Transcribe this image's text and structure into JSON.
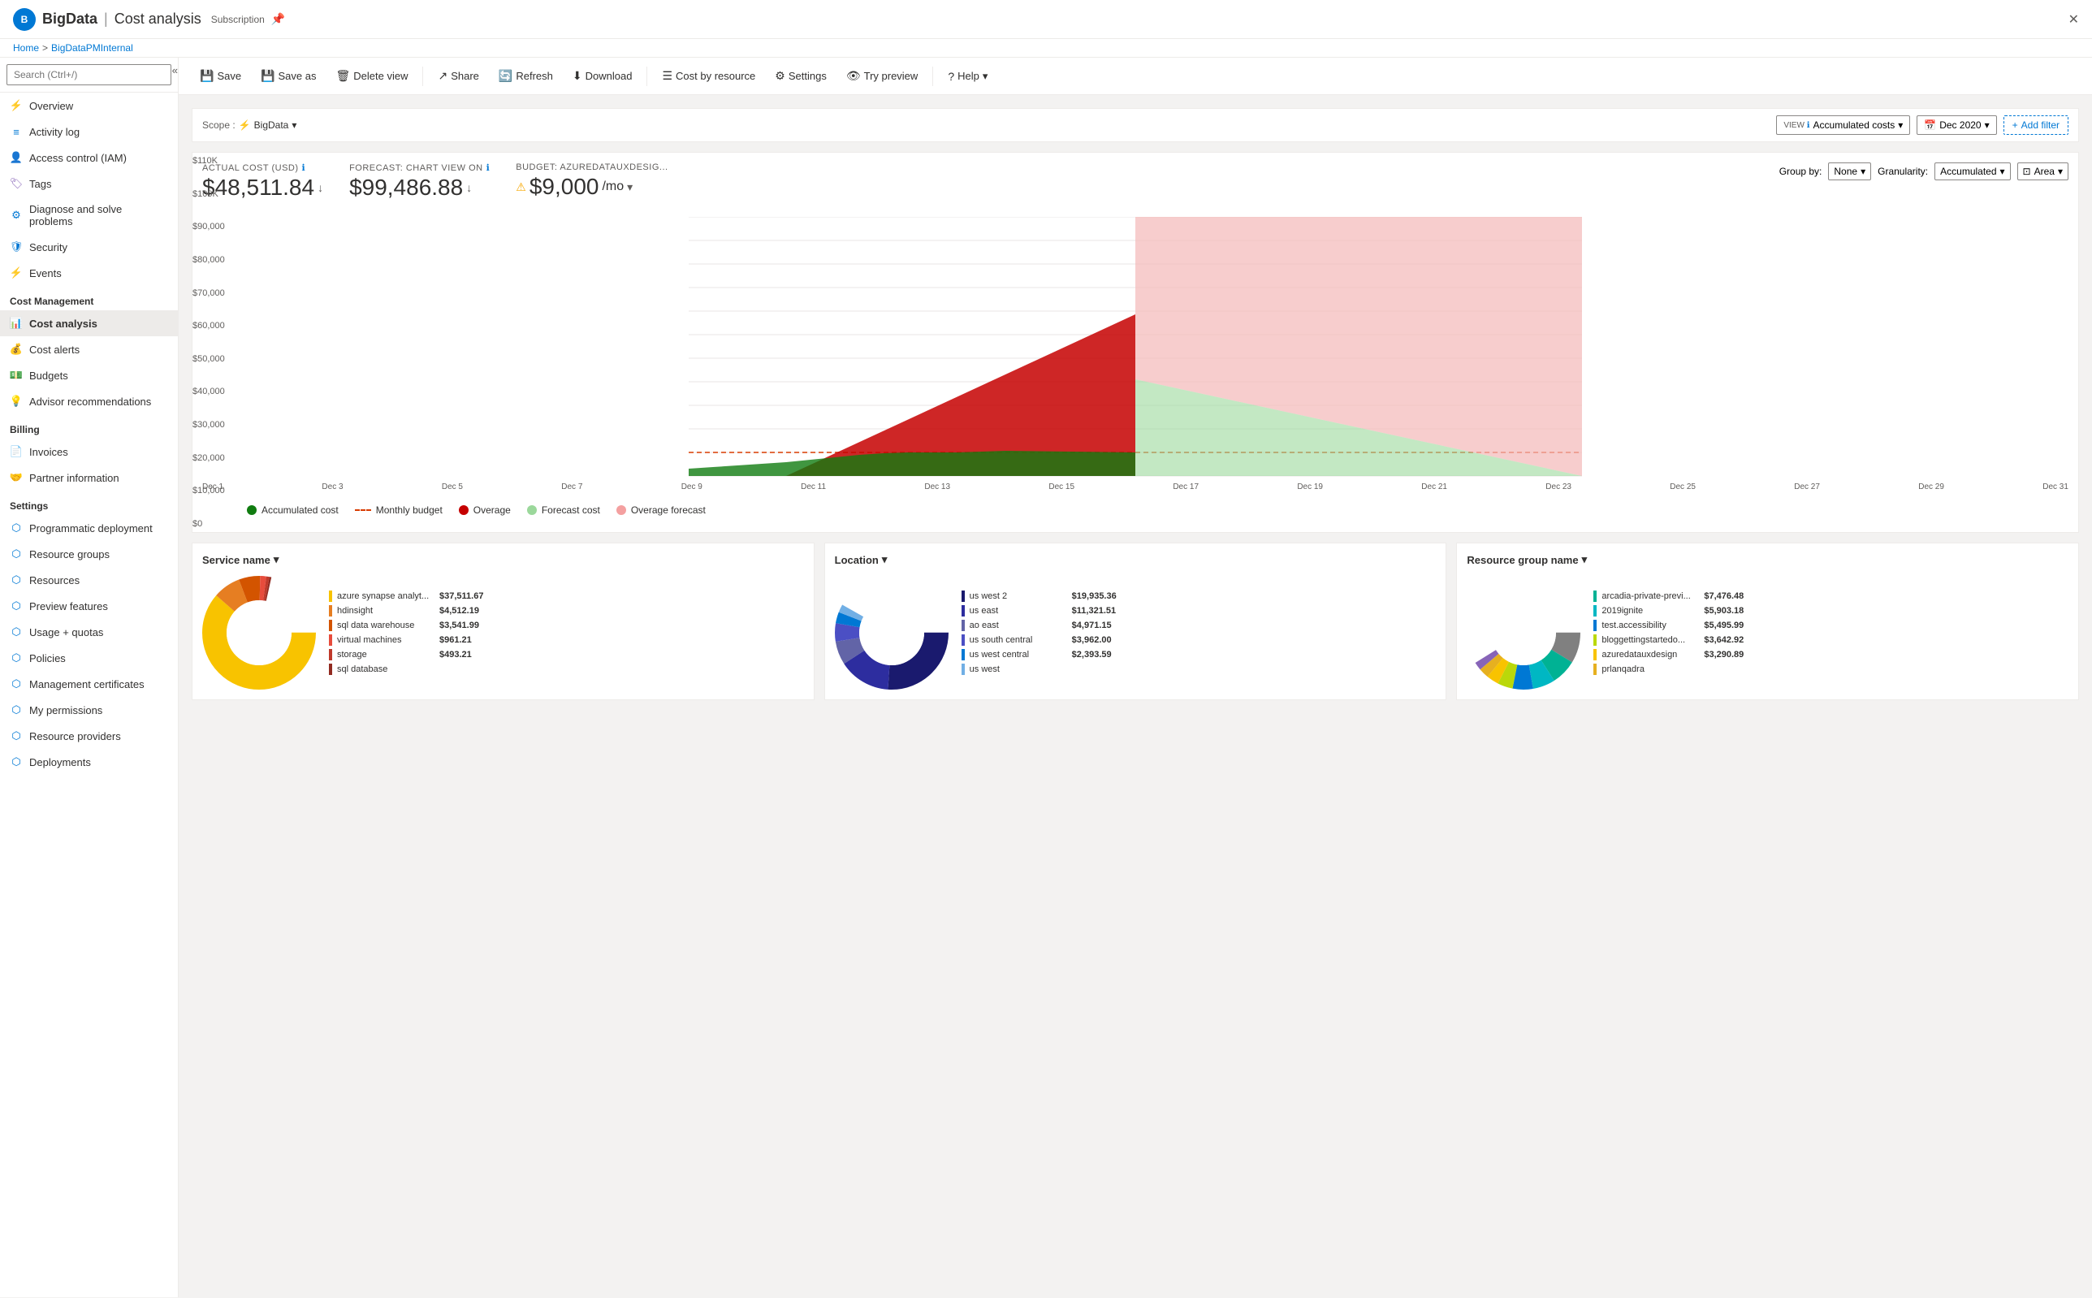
{
  "topbar": {
    "logo_text": "B",
    "main_title": "BigData",
    "separator": "|",
    "sub_title": "Cost analysis",
    "sub_label": "Subscription",
    "breadcrumb_home": "Home",
    "breadcrumb_arrow": ">",
    "breadcrumb_sub": "BigDataPMInternal",
    "close_icon": "✕",
    "pin_icon": "📌"
  },
  "sidebar": {
    "search_placeholder": "Search (Ctrl+/)",
    "collapse_icon": "«",
    "items": [
      {
        "id": "overview",
        "label": "Overview",
        "icon": "⚡",
        "color": "#f8a800"
      },
      {
        "id": "activity-log",
        "label": "Activity log",
        "icon": "≡",
        "color": "#0078d4"
      },
      {
        "id": "access-control",
        "label": "Access control (IAM)",
        "icon": "👤",
        "color": "#0078d4"
      },
      {
        "id": "tags",
        "label": "Tags",
        "icon": "🏷",
        "color": "#8764b8"
      },
      {
        "id": "diagnose",
        "label": "Diagnose and solve problems",
        "icon": "⚙",
        "color": "#0078d4"
      },
      {
        "id": "security",
        "label": "Security",
        "icon": "🛡",
        "color": "#0078d4"
      },
      {
        "id": "events",
        "label": "Events",
        "icon": "⚡",
        "color": "#f8a800"
      }
    ],
    "cost_management_label": "Cost Management",
    "cost_items": [
      {
        "id": "cost-analysis",
        "label": "Cost analysis",
        "icon": "📊",
        "color": "#107c10",
        "active": true
      },
      {
        "id": "cost-alerts",
        "label": "Cost alerts",
        "icon": "💰",
        "color": "#107c10"
      },
      {
        "id": "budgets",
        "label": "Budgets",
        "icon": "💵",
        "color": "#107c10"
      },
      {
        "id": "advisor",
        "label": "Advisor recommendations",
        "icon": "💡",
        "color": "#107c10"
      }
    ],
    "billing_label": "Billing",
    "billing_items": [
      {
        "id": "invoices",
        "label": "Invoices",
        "icon": "📄",
        "color": "#0078d4"
      },
      {
        "id": "partner-info",
        "label": "Partner information",
        "icon": "🤝",
        "color": "#0078d4"
      }
    ],
    "settings_label": "Settings",
    "settings_items": [
      {
        "id": "programmatic",
        "label": "Programmatic deployment",
        "icon": "⬡",
        "color": "#0078d4"
      },
      {
        "id": "resource-groups",
        "label": "Resource groups",
        "icon": "⬡",
        "color": "#0078d4"
      },
      {
        "id": "resources",
        "label": "Resources",
        "icon": "⬡",
        "color": "#0078d4"
      },
      {
        "id": "preview-features",
        "label": "Preview features",
        "icon": "⬡",
        "color": "#0078d4"
      },
      {
        "id": "usage-quotas",
        "label": "Usage + quotas",
        "icon": "⬡",
        "color": "#0078d4"
      },
      {
        "id": "policies",
        "label": "Policies",
        "icon": "⬡",
        "color": "#0078d4"
      },
      {
        "id": "mgmt-certs",
        "label": "Management certificates",
        "icon": "⬡",
        "color": "#0078d4"
      },
      {
        "id": "my-permissions",
        "label": "My permissions",
        "icon": "⬡",
        "color": "#0078d4"
      },
      {
        "id": "resource-providers",
        "label": "Resource providers",
        "icon": "⬡",
        "color": "#0078d4"
      },
      {
        "id": "deployments",
        "label": "Deployments",
        "icon": "⬡",
        "color": "#0078d4"
      }
    ]
  },
  "toolbar": {
    "save": "Save",
    "save_as": "Save as",
    "delete_view": "Delete view",
    "share": "Share",
    "refresh": "Refresh",
    "download": "Download",
    "cost_by_resource": "Cost by resource",
    "settings": "Settings",
    "try_preview": "Try preview",
    "help": "Help",
    "help_chevron": "▾"
  },
  "filters": {
    "scope_label": "Scope :",
    "scope_icon": "⚡",
    "scope_value": "BigData",
    "view_label": "VIEW",
    "view_info": "ℹ",
    "view_value": "Accumulated costs",
    "view_chevron": "▾",
    "date_icon": "📅",
    "date_value": "Dec 2020",
    "date_chevron": "▾",
    "add_filter_icon": "+",
    "add_filter": "Add filter"
  },
  "kpis": {
    "actual_cost_label": "ACTUAL COST (USD)",
    "actual_cost_info": "ℹ",
    "actual_cost_value": "$48,511.84",
    "actual_cost_arrow": "↓",
    "forecast_label": "FORECAST: CHART VIEW ON",
    "forecast_info": "ℹ",
    "forecast_value": "$99,486.88",
    "forecast_arrow": "↓",
    "budget_label": "BUDGET: AZUREDATAUXDESIG...",
    "budget_warning": "⚠",
    "budget_value": "$9,000",
    "budget_unit": "/mo",
    "budget_arrow": "▾"
  },
  "chart_controls": {
    "group_by_label": "Group by:",
    "group_by_value": "None",
    "group_by_chevron": "▾",
    "granularity_label": "Granularity:",
    "granularity_value": "Accumulated",
    "granularity_chevron": "▾",
    "chart_type": "Area",
    "chart_type_chevron": "▾"
  },
  "chart": {
    "y_labels": [
      "$110K",
      "$100K",
      "$90,000",
      "$80,000",
      "$70,000",
      "$60,000",
      "$50,000",
      "$40,000",
      "$30,000",
      "$20,000",
      "$10,000",
      "$0"
    ],
    "x_labels": [
      "Dec 1",
      "Dec 3",
      "Dec 5",
      "Dec 7",
      "Dec 9",
      "Dec 11",
      "Dec 13",
      "Dec 15",
      "Dec 17",
      "Dec 19",
      "Dec 21",
      "Dec 23",
      "Dec 25",
      "Dec 27",
      "Dec 29",
      "Dec 31"
    ],
    "budget_line_value": "$10,000",
    "colors": {
      "accumulated": "#107c10",
      "overage": "#c50000",
      "forecast": "#9bd89b",
      "overage_forecast": "#f4b8b8",
      "budget_line": "#d83b01"
    }
  },
  "legend": {
    "items": [
      {
        "label": "Accumulated cost",
        "type": "dot",
        "color": "#107c10"
      },
      {
        "label": "Monthly budget",
        "type": "dash",
        "color": "#d83b01"
      },
      {
        "label": "Overage",
        "type": "dot",
        "color": "#c50000"
      },
      {
        "label": "Forecast cost",
        "type": "dot",
        "color": "#9bd89b"
      },
      {
        "label": "Overage forecast",
        "type": "dot",
        "color": "#f4a0a0"
      }
    ]
  },
  "donut_charts": [
    {
      "id": "service-name",
      "title": "Service name",
      "chevron": "▾",
      "items": [
        {
          "label": "azure synapse analyt...",
          "value": "$37,511.67",
          "color": "#f8c300"
        },
        {
          "label": "hdinsight",
          "value": "$4,512.19",
          "color": "#e67e22"
        },
        {
          "label": "sql data warehouse",
          "value": "$3,541.99",
          "color": "#f39c12"
        },
        {
          "label": "virtual machines",
          "value": "$961.21",
          "color": "#e74c3c"
        },
        {
          "label": "storage",
          "value": "$493.21",
          "color": "#c0392b"
        },
        {
          "label": "sql database",
          "value": "",
          "color": "#922b21"
        }
      ],
      "donut_colors": [
        "#f8c300",
        "#e67e22",
        "#d35400",
        "#e74c3c",
        "#c0392b",
        "#922b21",
        "#f0e68c",
        "#ffd700"
      ]
    },
    {
      "id": "location",
      "title": "Location",
      "chevron": "▾",
      "items": [
        {
          "label": "us west 2",
          "value": "$19,935.36",
          "color": "#6264a7"
        },
        {
          "label": "us east",
          "value": "$11,321.51",
          "color": "#4b4fc4"
        },
        {
          "label": "ao east",
          "value": "$4,971.15",
          "color": "#0078d4"
        },
        {
          "label": "us south central",
          "value": "$3,962.00",
          "color": "#2b88d8"
        },
        {
          "label": "us west central",
          "value": "$2,393.59",
          "color": "#71afe5"
        },
        {
          "label": "us west",
          "value": "",
          "color": "#a0c8f0"
        }
      ],
      "donut_colors": [
        "#1a1a6e",
        "#2d2d9f",
        "#6264a7",
        "#4b4fc4",
        "#0078d4",
        "#2b88d8",
        "#71afe5",
        "#a0c8f0",
        "#c7e0f4",
        "#deecf9"
      ]
    },
    {
      "id": "resource-group-name",
      "title": "Resource group name",
      "chevron": "▾",
      "items": [
        {
          "label": "arcadia-private-previ...",
          "value": "$7,476.48",
          "color": "#00b294"
        },
        {
          "label": "2019ignite",
          "value": "$5,903.18",
          "color": "#00b7c3"
        },
        {
          "label": "test.accessibility",
          "value": "$5,495.99",
          "color": "#0078d4"
        },
        {
          "label": "bloggettingstartedo...",
          "value": "$3,642.92",
          "color": "#bad80a"
        },
        {
          "label": "azuredatauxdesign",
          "value": "$3,290.89",
          "color": "#f8c300"
        },
        {
          "label": "prlanqadra",
          "value": "",
          "color": "#e6b020"
        }
      ],
      "donut_colors": [
        "#00b294",
        "#00b7c3",
        "#0078d4",
        "#bad80a",
        "#f8c300",
        "#e6b020",
        "#8764b8",
        "#c239b3",
        "#9a0089",
        "#004b1c"
      ]
    }
  ]
}
